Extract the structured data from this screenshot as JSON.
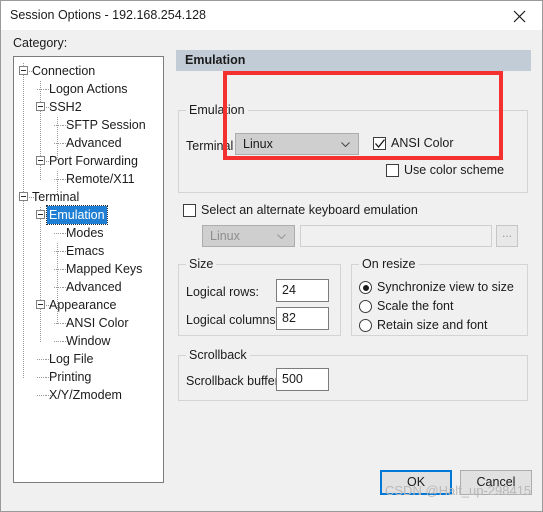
{
  "window": {
    "title": "Session Options - 192.168.254.128",
    "close_icon": "close-icon"
  },
  "category": {
    "label": "Category:",
    "tree": [
      {
        "label": "Connection",
        "depth": 0,
        "expander": "collapse",
        "selected": false
      },
      {
        "label": "Logon Actions",
        "depth": 1,
        "expander": "none",
        "selected": false
      },
      {
        "label": "SSH2",
        "depth": 1,
        "expander": "collapse",
        "selected": false
      },
      {
        "label": "SFTP Session",
        "depth": 2,
        "expander": "none",
        "selected": false
      },
      {
        "label": "Advanced",
        "depth": 2,
        "expander": "none",
        "selected": false
      },
      {
        "label": "Port Forwarding",
        "depth": 1,
        "expander": "collapse",
        "selected": false
      },
      {
        "label": "Remote/X11",
        "depth": 2,
        "expander": "none",
        "selected": false
      },
      {
        "label": "Terminal",
        "depth": 0,
        "expander": "collapse",
        "selected": false
      },
      {
        "label": "Emulation",
        "depth": 1,
        "expander": "collapse",
        "selected": true
      },
      {
        "label": "Modes",
        "depth": 2,
        "expander": "none",
        "selected": false
      },
      {
        "label": "Emacs",
        "depth": 2,
        "expander": "none",
        "selected": false
      },
      {
        "label": "Mapped Keys",
        "depth": 2,
        "expander": "none",
        "selected": false
      },
      {
        "label": "Advanced",
        "depth": 2,
        "expander": "none",
        "selected": false
      },
      {
        "label": "Appearance",
        "depth": 1,
        "expander": "collapse",
        "selected": false
      },
      {
        "label": "ANSI Color",
        "depth": 2,
        "expander": "none",
        "selected": false
      },
      {
        "label": "Window",
        "depth": 2,
        "expander": "none",
        "selected": false
      },
      {
        "label": "Log File",
        "depth": 1,
        "expander": "none",
        "selected": false
      },
      {
        "label": "Printing",
        "depth": 1,
        "expander": "none",
        "selected": false
      },
      {
        "label": "X/Y/Zmodem",
        "depth": 1,
        "expander": "none",
        "selected": false
      }
    ]
  },
  "pane": {
    "header": "Emulation",
    "emulation_group": {
      "title": "Emulation",
      "terminal_label": "Terminal",
      "terminal_value": "Linux",
      "terminal_options": [
        "Linux"
      ],
      "ansi_color_label": "ANSI Color",
      "ansi_color_checked": true,
      "use_color_scheme_label": "Use color scheme",
      "use_color_scheme_checked": false,
      "alt_keyboard_label": "Select an alternate keyboard emulation",
      "alt_keyboard_checked": false,
      "alt_keyboard_value": "Linux",
      "alt_keyboard_options": [
        "Linux"
      ],
      "alt_keyboard_path_value": "",
      "browse_label": "..."
    },
    "size_group": {
      "title": "Size",
      "rows_label": "Logical rows:",
      "rows_value": "24",
      "cols_label": "Logical columns:",
      "cols_value": "82"
    },
    "resize_group": {
      "title": "On resize",
      "options": [
        {
          "label": "Synchronize view to size",
          "selected": true
        },
        {
          "label": "Scale the font",
          "selected": false
        },
        {
          "label": "Retain size and font",
          "selected": false
        }
      ]
    },
    "scrollback_group": {
      "title": "Scrollback",
      "buffer_label": "Scrollback buffer:",
      "buffer_value": "500"
    }
  },
  "footer": {
    "ok_label": "OK",
    "cancel_label": "Cancel"
  },
  "annotation": {
    "color": "#f4312f"
  },
  "watermark": "CSDN @Half_up-298415"
}
